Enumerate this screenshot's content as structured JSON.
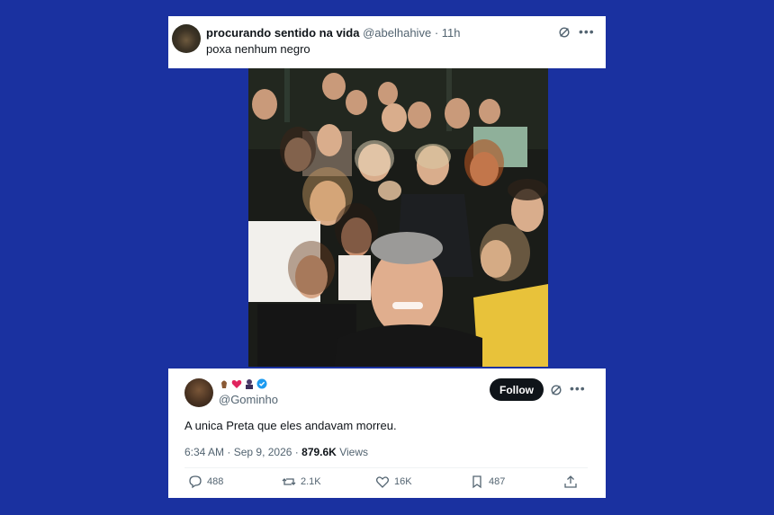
{
  "quoted_post": {
    "display_name": "procurando sentido na vida",
    "handle": "@abelhahive",
    "age": "11h",
    "text": "poxa nenhum negro"
  },
  "post": {
    "emoji_name": [
      "pinched-fingers-dark",
      "red-heart",
      "zombie-dark",
      "verified-badge"
    ],
    "handle": "@Gominho",
    "follow_label": "Follow",
    "text": "A unica Preta que eles andavam morreu.",
    "time": "6:34 AM",
    "date": "Sep 9, 2026",
    "views_count": "879.6K",
    "views_label": "Views",
    "replies": "488",
    "reposts": "2.1K",
    "likes": "16K",
    "bookmarks": "487"
  },
  "colors": {
    "background": "#1a31a0",
    "text_primary": "#0f1419",
    "text_secondary": "#536471",
    "verified": "#1d9bf0"
  }
}
